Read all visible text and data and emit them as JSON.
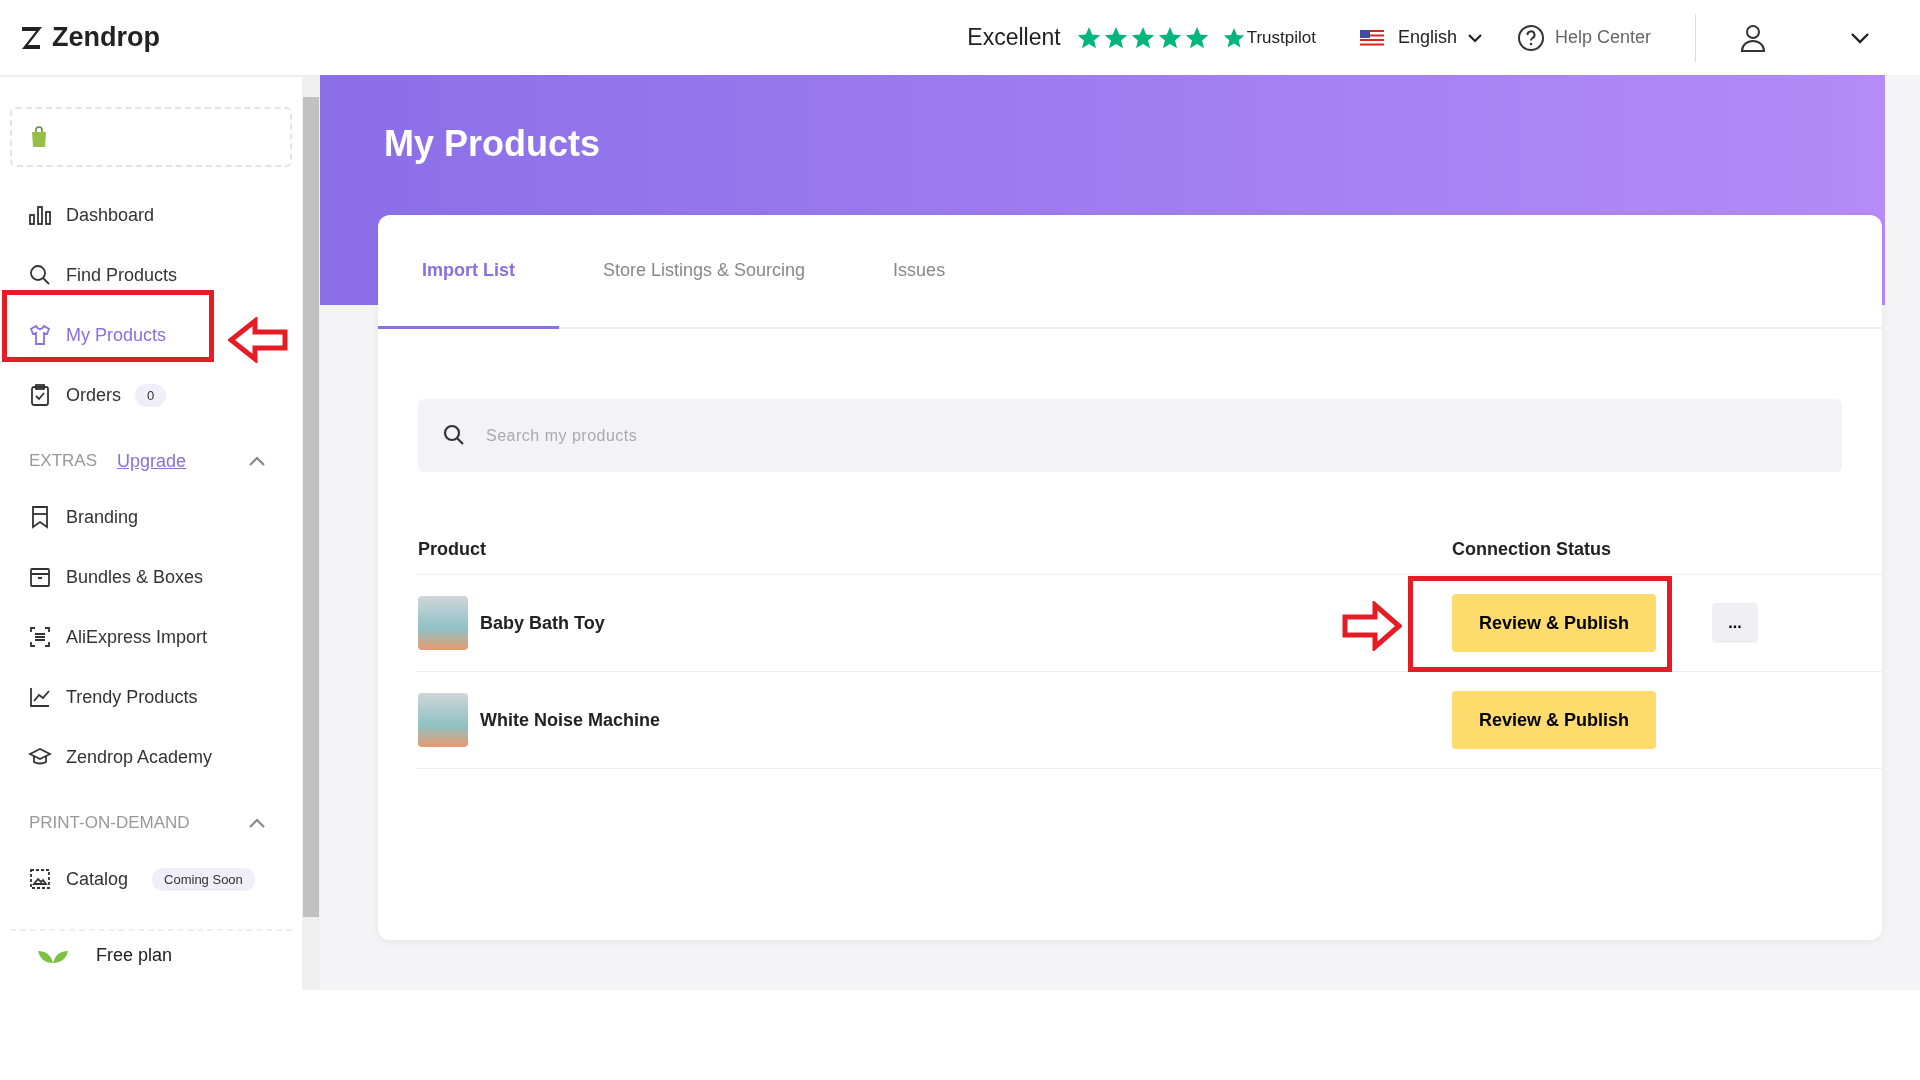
{
  "header": {
    "logo": "Zendrop",
    "rating": {
      "label": "Excellent",
      "stars": 5,
      "brand": "Trustpilot"
    },
    "language": "English",
    "help": "Help Center"
  },
  "sidebar": {
    "items": [
      {
        "label": "Dashboard",
        "selected": false
      },
      {
        "label": "Find Products",
        "selected": false
      },
      {
        "label": "My Products",
        "selected": true
      },
      {
        "label": "Orders",
        "selected": false,
        "badge": "0"
      }
    ],
    "sections": [
      {
        "title": "EXTRAS",
        "link": "Upgrade",
        "expanded": true,
        "items": [
          {
            "label": "Branding",
            "selected": false
          },
          {
            "label": "Bundles & Boxes",
            "selected": false
          },
          {
            "label": "AliExpress Import",
            "selected": false
          },
          {
            "label": "Trendy Products",
            "selected": false
          },
          {
            "label": "Zendrop Academy",
            "selected": false
          }
        ]
      },
      {
        "title": "PRINT-ON-DEMAND",
        "expanded": true,
        "items": [
          {
            "label": "Catalog",
            "selected": false,
            "badge": "Coming Soon"
          }
        ]
      }
    ],
    "plan": "Free plan"
  },
  "page": {
    "title": "My Products",
    "tabs": [
      {
        "label": "Import List",
        "selected": true
      },
      {
        "label": "Store Listings & Sourcing",
        "selected": false
      },
      {
        "label": "Issues",
        "selected": false
      }
    ],
    "search": {
      "placeholder": "Search my products"
    },
    "table": {
      "columns": [
        "Product",
        "Connection Status"
      ],
      "rows": [
        {
          "name": "Baby Bath Toy",
          "action": "Review & Publish",
          "more": "...",
          "highlighted": true
        },
        {
          "name": "White Noise Machine",
          "action": "Review & Publish",
          "highlighted": false
        }
      ]
    }
  }
}
